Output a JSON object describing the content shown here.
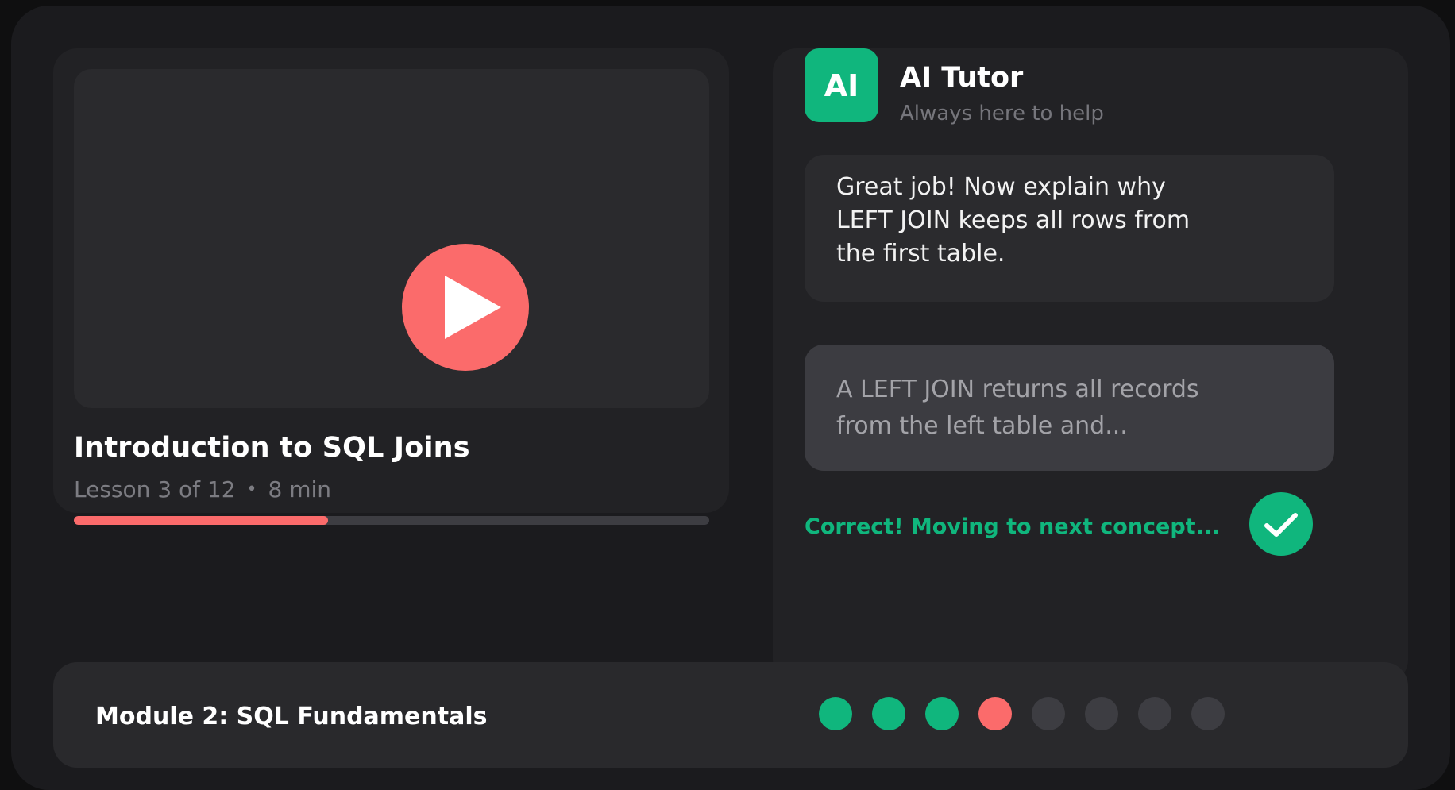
{
  "lesson": {
    "title": "Introduction to SQL Joins",
    "meta_lesson": "Lesson 3 of 12",
    "meta_separator": "•",
    "meta_duration": "8 min",
    "progress_fraction": 0.4
  },
  "tutor": {
    "avatar_initials": "AI",
    "name": "AI Tutor",
    "subtitle": "Always here to help",
    "message": "Great job! Now explain why LEFT JOIN keeps all rows from the first table.",
    "answer": "A LEFT JOIN returns all records from the left table and...",
    "status": "Correct! Moving to next concept..."
  },
  "module": {
    "title": "Module 2: SQL Fundamentals",
    "steps": [
      "complete",
      "complete",
      "complete",
      "current",
      "pending",
      "pending",
      "pending",
      "pending"
    ]
  },
  "colors": {
    "accent_green": "#10b67d",
    "accent_coral": "#fb6b6b",
    "pending": "#3d3d42"
  },
  "icons": {
    "play": "play-icon",
    "check": "check-icon"
  }
}
